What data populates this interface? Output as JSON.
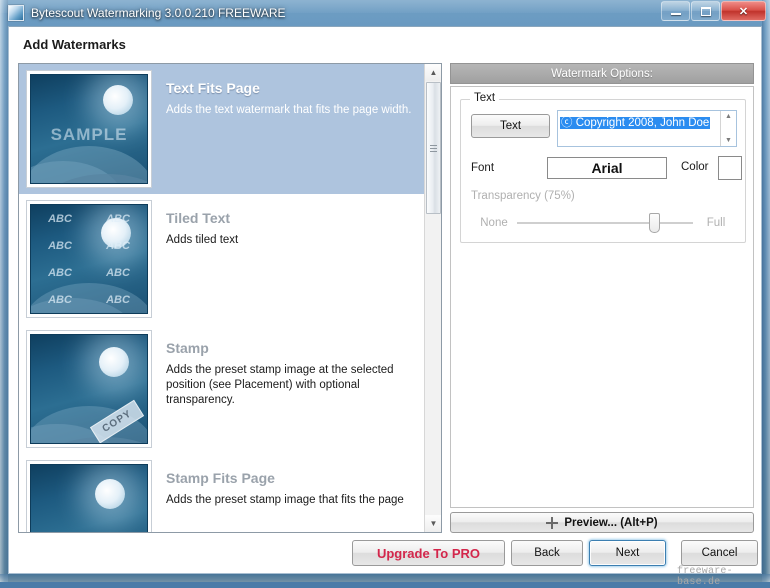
{
  "window": {
    "title": "Bytescout Watermarking 3.0.0.210 FREEWARE",
    "app_icon": "app-window-icon",
    "minimize_label": "Minimize",
    "maximize_label": "Maximize",
    "close_label": "✕"
  },
  "page": {
    "heading": "Add Watermarks"
  },
  "watermark_list": {
    "items": [
      {
        "title": "Text Fits Page",
        "description": "Adds the text watermark that fits the page width.",
        "selected": true,
        "thumb": "sample-landscape-thumb",
        "thumb_text": "SAMPLE"
      },
      {
        "title": "Tiled Text",
        "description": "Adds tiled text",
        "selected": false,
        "thumb": "tiled-abc-thumb",
        "thumb_text": "ABC"
      },
      {
        "title": "Stamp",
        "description": "Adds the preset stamp image at the selected position (see Placement) with optional transparency.",
        "selected": false,
        "thumb": "copy-stamp-thumb",
        "thumb_text": "COPY"
      },
      {
        "title": "Stamp Fits Page",
        "description": "Adds the preset stamp image that fits the page",
        "selected": false,
        "thumb": "stamp-fits-page-thumb",
        "thumb_text": ""
      }
    ],
    "scroll_up": "▲",
    "scroll_down": "▼"
  },
  "options": {
    "header": "Watermark Options:",
    "text_group_legend": "Text",
    "text_button": "Text",
    "text_value": "ⓒ Copyright 2008, John Doe",
    "text_selected": true,
    "spin_up": "▲",
    "spin_down": "▼",
    "font_label": "Font",
    "font_value": "Arial",
    "color_label": "Color",
    "color_value": "#ffffff",
    "transparency_label": "Transparency (75%)",
    "transparency_percent": 75,
    "transparency_min_label": "None",
    "transparency_max_label": "Full",
    "transparency_disabled": true,
    "preview_button": "Preview... (Alt+P)",
    "preview_icon": "move-icon"
  },
  "footer": {
    "upgrade": "Upgrade To PRO",
    "back": "Back",
    "next": "Next",
    "cancel": "Cancel",
    "watermark_credit": "freeware-base.de"
  },
  "colors": {
    "selection_blue": "#aec4de",
    "text_highlight": "#2b8cf0",
    "upgrade_red": "#d3264b",
    "titlebar_blue": "#2b4f70"
  }
}
